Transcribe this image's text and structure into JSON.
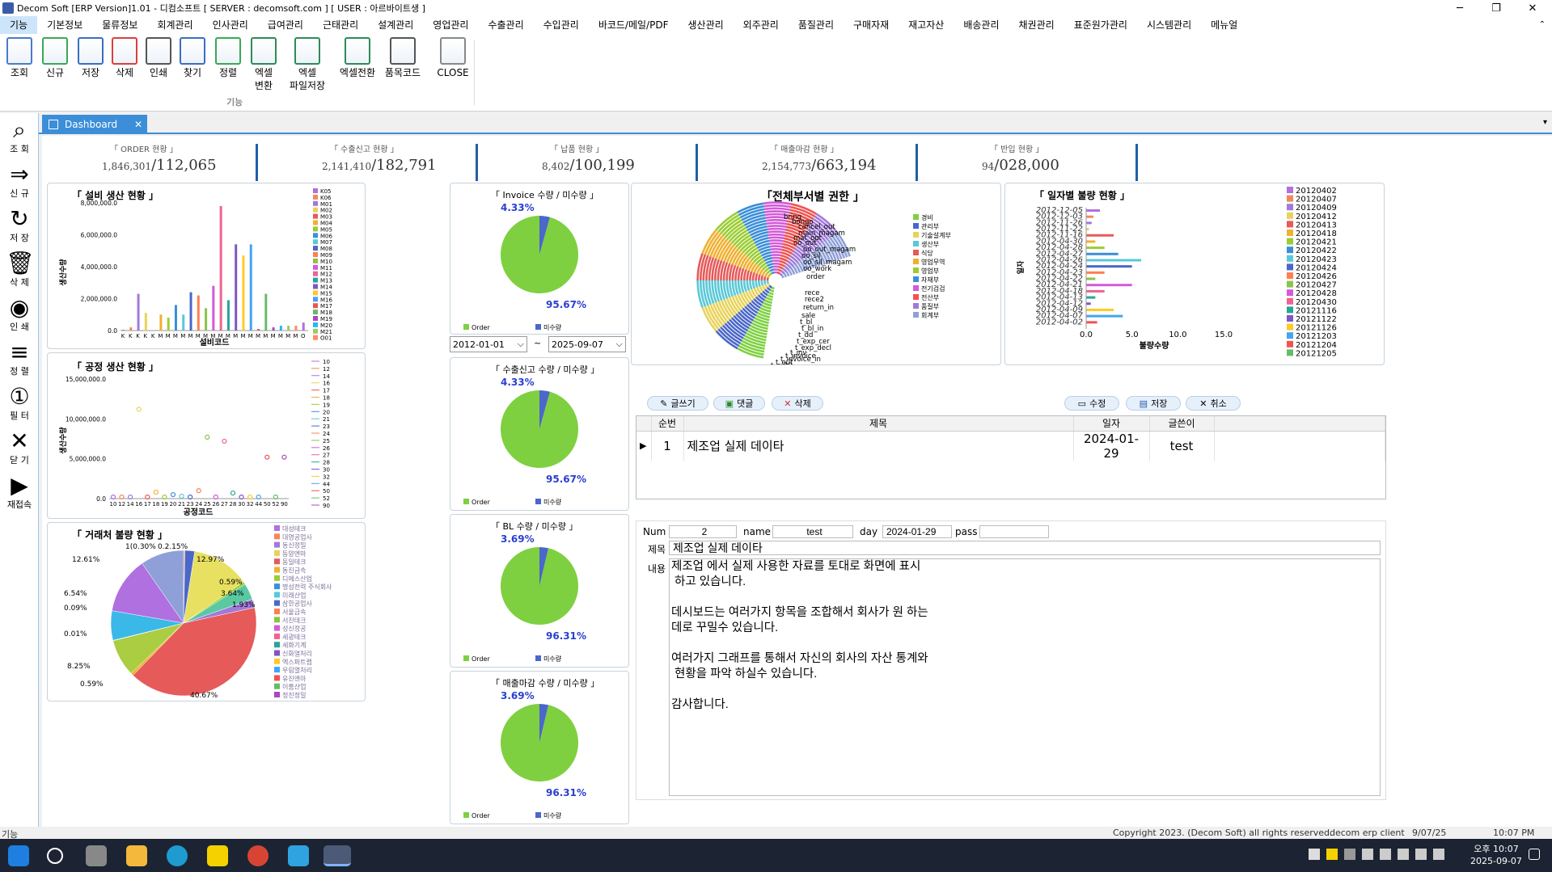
{
  "window": {
    "title": "Decom Soft [ERP Version]1.01 - 디컴소프트 [ SERVER : decomsoft.com ] [ USER : 아르바이트생 ]",
    "min": "─",
    "max": "❐",
    "close": "✕"
  },
  "menus": [
    "기능",
    "기본정보",
    "물류정보",
    "회계관리",
    "인사관리",
    "급여관리",
    "근태관리",
    "설계관리",
    "영업관리",
    "수출관리",
    "수입관리",
    "바코드/메일/PDF",
    "생산관리",
    "외주관리",
    "품질관리",
    "구매자재",
    "재고자산",
    "배송관리",
    "채권관리",
    "표준원가관리",
    "시스템관리",
    "메뉴얼"
  ],
  "ribbon": {
    "buttons": [
      [
        "조회"
      ],
      [
        "신규"
      ],
      [
        "저장"
      ],
      [
        "삭제"
      ],
      [
        "인쇄"
      ],
      [
        "찾기"
      ],
      [
        "정렬"
      ],
      [
        "엑셀",
        "변환"
      ],
      [
        "엑셀",
        "파일저장"
      ],
      [
        "엑셀전환"
      ],
      [
        "품목코드"
      ],
      [
        "CLOSE"
      ]
    ],
    "group": "기능"
  },
  "leftbar": [
    "조 회",
    "신 규",
    "저 장",
    "삭 제",
    "인 쇄",
    "정 렬",
    "필 터",
    "닫 기",
    "재접속"
  ],
  "tab": {
    "label": "Dashboard",
    "close": "✕"
  },
  "stats": [
    {
      "label": "「 ORDER      현황 」",
      "v1": "1,846,301",
      "v2": "/112,065"
    },
    {
      "label": "「 수출신고      현황 」",
      "v1": "2,141,410",
      "v2": "/182,791"
    },
    {
      "label": "「 납품      현황 」",
      "v1": "8,402",
      "v2": "/100,199"
    },
    {
      "label": "「 매출마감      현황 」",
      "v1": "2,154,773",
      "v2": "/663,194"
    },
    {
      "label": "「 반입      현황 」",
      "v1": "94",
      "v2": "/028,000"
    }
  ],
  "pies": [
    {
      "title": "「 Invoice 수량 / 미수량 」",
      "a": "4.33%",
      "b": "95.67%",
      "fa": 0.0433
    },
    {
      "title": "「 수출신고 수량 / 미수량 」",
      "a": "4.33%",
      "b": "95.67%",
      "fa": 0.0433
    },
    {
      "title": "「 BL 수량 / 미수량 」",
      "a": "3.69%",
      "b": "96.31%",
      "fa": 0.0369
    },
    {
      "title": "「 매출마감 수량 / 미수량 」",
      "a": "3.69%",
      "b": "96.31%",
      "fa": 0.0369
    }
  ],
  "pie_legend": {
    "order": "Order",
    "unorder": "미수량"
  },
  "daterange": {
    "from": "2012-01-01",
    "sep": "~",
    "to": "2025-09-07"
  },
  "colors": {
    "green": "#7ed040",
    "blue": "#4a67c9",
    "accent": "#3c8ed8"
  },
  "chart1": {
    "title": "「 설비 생산 현황 」",
    "ylabel": "생산수량",
    "xlabel": "설비코드",
    "yticks": [
      "8,000,000.0",
      "6,000,000.0",
      "4,000,000.0",
      "2,000,000.0",
      "0.0"
    ],
    "legend": [
      "K05",
      "K06",
      "M01",
      "M02",
      "M03",
      "M04",
      "M05",
      "M06",
      "M07",
      "M08",
      "M09",
      "M10",
      "M11",
      "M12",
      "M13",
      "M14",
      "M15",
      "M16",
      "M17",
      "M18",
      "M19",
      "M20",
      "M21",
      "O01"
    ],
    "xticks": [
      "K",
      "K",
      "K",
      "K",
      "K",
      "M",
      "M",
      "M",
      "M",
      "M",
      "M",
      "M",
      "M",
      "M",
      "M",
      "M",
      "M",
      "M",
      "M",
      "M",
      "M",
      "M",
      "M",
      "M",
      "O"
    ],
    "values": [
      0.05,
      0.2,
      2.3,
      1.1,
      0,
      1.0,
      0.8,
      1.6,
      1.0,
      2.4,
      2.2,
      1.4,
      2.8,
      7.8,
      1.9,
      5.4,
      4.7,
      5.4,
      0.1,
      2.3,
      0.2,
      0.3,
      0.3,
      0.3,
      0.5
    ]
  },
  "chart2": {
    "title": "「 공정 생산 현황 」",
    "ylabel": "생산수량",
    "xlabel": "공정코드",
    "yticks": [
      "15,000,000.0",
      "10,000,000.0",
      "5,000,000.0",
      "0.0"
    ],
    "legend": [
      "10",
      "12",
      "14",
      "16",
      "17",
      "18",
      "19",
      "20",
      "21",
      "23",
      "24",
      "25",
      "26",
      "27",
      "28",
      "30",
      "32",
      "44",
      "50",
      "52",
      "90"
    ],
    "xticks": [
      "10",
      "12",
      "14",
      "16",
      "17",
      "18",
      "19",
      "20",
      "21",
      "23",
      "24",
      "25",
      "26",
      "27",
      "28",
      "30",
      "32",
      "44",
      "50",
      "52",
      "90"
    ]
  },
  "chart3": {
    "title": "「 거래처 불량 현황 」",
    "labels": [
      "1(0.30%",
      "0.2.15%",
      "12.61%",
      "12.97%",
      "0.59%",
      "3.64%",
      "1.93%",
      "6.54%",
      "0.09%",
      "0.01%",
      "8.25%",
      "0.59%",
      "40.67%"
    ],
    "legend": [
      "대성테크",
      "대영공업사",
      "동신정밀",
      "동양엔마",
      "동일테크",
      "동진금속",
      "디에스산업",
      "명성전력 주식회사",
      "미래산업",
      "삼한공업사",
      "서울금속",
      "서진테크",
      "성신정공",
      "세광테크",
      "세화기계",
      "신화열처리",
      "엑스퍼트랩",
      "우림열처리",
      "유진엔마",
      "이룸산업",
      "정진정밀"
    ]
  },
  "chart4": {
    "title": "「전체부서별 권한 」",
    "labels": [
      "bring",
      "bongo",
      "cancel_out",
      "main_magam",
      "mat_out",
      "oo_out",
      "oo_out_magam",
      "oo_sil",
      "oo_sil_magam",
      "oo_work",
      "order",
      "rece",
      "rece2",
      "return_in",
      "sale",
      "t_bl",
      "t_bl_in",
      "t_dd",
      "t_exp_cer",
      "t_exp_decl",
      "t_inv",
      "t_invoice",
      "t_invoice_in",
      "t_out",
      "t_out2"
    ],
    "legend": [
      "경비",
      "관리부",
      "기술설계부",
      "생산부",
      "식당",
      "영업무역",
      "영업부",
      "자재부",
      "전기검검",
      "전산부",
      "품질부",
      "회계부"
    ]
  },
  "chart5": {
    "title": "「 일자별 불량 현황 」",
    "ylabel": "일자",
    "xlabel": "불량수량",
    "xticks": [
      "0.0",
      "5.0",
      "10.0",
      "15.0"
    ],
    "ylabels": [
      "2012-12-05",
      "2012-12-03",
      "2012-11-26",
      "2012-11-22",
      "2012-11-16",
      "2012-04-30",
      "2012-04-28",
      "2012-04-27",
      "2012-04-26",
      "2012-04-24",
      "2012-04-23",
      "2012-04-22",
      "2012-04-21",
      "2012-04-18",
      "2012-04-13",
      "2012-04-12",
      "2012-04-09",
      "2012-04-07",
      "2012-04-02"
    ],
    "legend": [
      "20120402",
      "20120407",
      "20120409",
      "20120412",
      "20120413",
      "20120418",
      "20120421",
      "20120422",
      "20120423",
      "20120424",
      "20120426",
      "20120427",
      "20120428",
      "20120430",
      "20121116",
      "20121122",
      "20121126",
      "20121203",
      "20121204",
      "20121205"
    ]
  },
  "board": {
    "buttons": [
      "글쓰기",
      "댓글",
      "삭제",
      "수정",
      "저장",
      "취소"
    ],
    "cols": [
      "순번",
      "제목",
      "일자",
      "글쓴이"
    ],
    "rows": [
      {
        "num": "1",
        "title": "제조업 실제 데이타",
        "date": "2024-01-29",
        "writer": "test",
        "marker": "▶"
      }
    ]
  },
  "detail": {
    "num_label": "Num",
    "num": "2",
    "name_label": "name",
    "name": "test",
    "day_label": "day",
    "day": "2024-01-29",
    "pass_label": "pass",
    "pass": "",
    "title_label": "제목",
    "title": "제조업 실제 데이타",
    "content_label": "내용",
    "content": "제조업 에서 실제 사용한 자료를 토대로 화면에 표시\n 하고 있습니다.\n\n데시보드는 여러가지 항목을 조합해서 회사가 원 하는\n데로 꾸밀수 있습니다.\n\n여러가지 그래프를 통해서 자신의 회사의 자산 통계와\n 현황을 파악 하실수 있습니다.\n\n감사합니다."
  },
  "status": {
    "left": "기능",
    "copyright": "Copyright 2023. (Decom Soft) all rights reserved.",
    "client": "decom erp client",
    "date": "9/07/25",
    "time": "10:07 PM"
  },
  "taskbar": {
    "time": "오후 10:07",
    "date": "2025-09-07"
  }
}
